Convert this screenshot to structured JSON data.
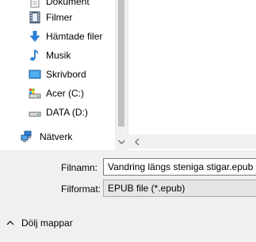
{
  "nav": {
    "items": [
      {
        "label": "Dokument",
        "icon": "documents-icon"
      },
      {
        "label": "Filmer",
        "icon": "videos-icon"
      },
      {
        "label": "Hämtade filer",
        "icon": "downloads-icon"
      },
      {
        "label": "Musik",
        "icon": "music-icon"
      },
      {
        "label": "Skrivbord",
        "icon": "desktop-icon"
      },
      {
        "label": "Acer (C:)",
        "icon": "drive-c-icon"
      },
      {
        "label": "DATA (D:)",
        "icon": "drive-d-icon"
      }
    ],
    "network": {
      "label": "Nätverk",
      "icon": "network-icon"
    },
    "scroll_down_glyph": "⌄",
    "scroll_left_glyph": "<"
  },
  "form": {
    "filename_label": "Filnamn:",
    "filename_value": "Vandring längs steniga stigar.epub",
    "filetype_label": "Filformat:",
    "filetype_value": "EPUB file (*.epub)"
  },
  "footer": {
    "hide_folders_label": "Dölj mappar"
  }
}
